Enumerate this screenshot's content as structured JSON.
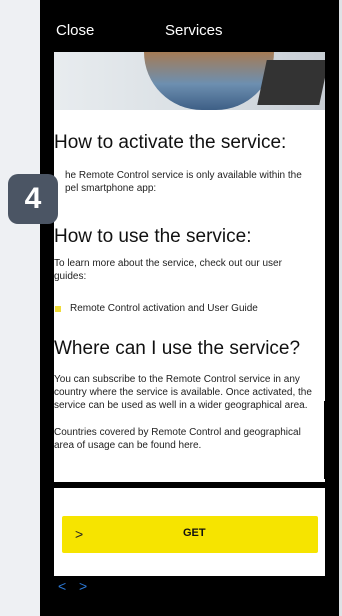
{
  "header": {
    "close_label": "Close",
    "title": "Services"
  },
  "sections": {
    "activate_heading": "How to activate the service:",
    "activate_text": "he Remote Control service is only available within the\npel smartphone app:",
    "use_heading": "How to use the service:",
    "use_text": "To learn more about the service, check out our user guides:",
    "use_bullet": "Remote Control activation and User Guide",
    "where_heading": "Where can I use the service?",
    "where_text_1": "You can subscribe to the Remote Control service in any country where the service is available. Once activated, the service can be used as well in a wider geographical area.",
    "where_text_2": "Countries covered by Remote Control and geographical area of usage can be found here."
  },
  "cta": {
    "label": "GET",
    "chevron": ">"
  },
  "nav": {
    "back": "<",
    "forward": ">"
  },
  "badge": {
    "number": "4"
  },
  "colors": {
    "accent_yellow": "#f6e400",
    "badge_bg": "#4b5564",
    "nav_blue": "#2c7ad8"
  }
}
